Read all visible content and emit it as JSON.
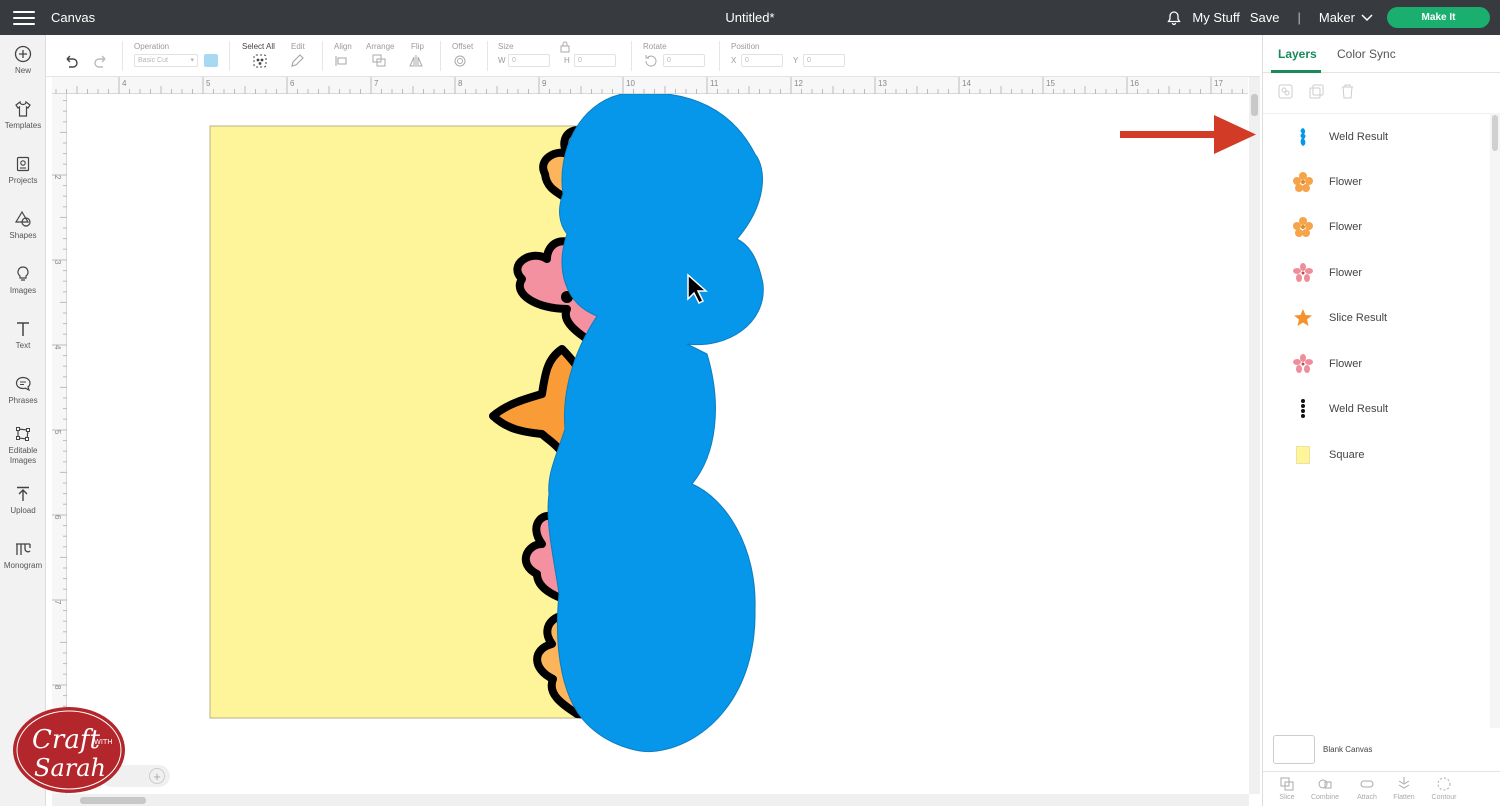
{
  "topbar": {
    "app_title": "Canvas",
    "doc_title": "Untitled*",
    "my_stuff": "My Stuff",
    "save": "Save",
    "separator": "|",
    "machine": "Maker",
    "make_it": "Make It"
  },
  "sidebar": {
    "items": [
      {
        "label": "New",
        "icon": "plus-circle-icon"
      },
      {
        "label": "Templates",
        "icon": "shirt-icon"
      },
      {
        "label": "Projects",
        "icon": "projects-icon"
      },
      {
        "label": "Shapes",
        "icon": "shapes-icon"
      },
      {
        "label": "Images",
        "icon": "lightbulb-icon"
      },
      {
        "label": "Text",
        "icon": "text-icon"
      },
      {
        "label": "Phrases",
        "icon": "speech-bubble-icon"
      },
      {
        "label": "Editable Images",
        "icon": "editable-images-icon"
      },
      {
        "label": "Upload",
        "icon": "upload-icon"
      },
      {
        "label": "Monogram",
        "icon": "monogram-icon"
      }
    ]
  },
  "toolbar": {
    "operation_label": "Operation",
    "operation_value": "Basic Cut",
    "operation_color": "#a9d8f2",
    "select_all": "Select All",
    "edit": "Edit",
    "align": "Align",
    "arrange": "Arrange",
    "flip": "Flip",
    "offset": "Offset",
    "size": "Size",
    "w": "W",
    "w_value": "0",
    "h": "H",
    "h_value": "0",
    "rotate": "Rotate",
    "rotate_value": "0",
    "position": "Position",
    "x": "X",
    "x_value": "0",
    "y": "Y",
    "y_value": "0"
  },
  "ruler": {
    "top_ticks": [
      "3",
      "4",
      "5",
      "6",
      "7",
      "8",
      "9",
      "10",
      "11",
      "12",
      "13",
      "14",
      "15",
      "16",
      "17"
    ],
    "left_ticks": [
      "1",
      "2",
      "3",
      "4",
      "5",
      "6",
      "7",
      "8"
    ]
  },
  "panel": {
    "tabs": [
      "Layers",
      "Color Sync"
    ],
    "layers": [
      {
        "name": "Weld Result",
        "icon": "blue-weld-icon",
        "color": "#0696ea"
      },
      {
        "name": "Flower",
        "icon": "flower-icon",
        "color": "#f5a44a"
      },
      {
        "name": "Flower",
        "icon": "flower-icon",
        "color": "#f5a44a"
      },
      {
        "name": "Flower",
        "icon": "flower-icon",
        "color": "#f08d9a"
      },
      {
        "name": "Slice Result",
        "icon": "star-flower-icon",
        "color": "#f5922d"
      },
      {
        "name": "Flower",
        "icon": "flower-icon",
        "color": "#f08d9a"
      },
      {
        "name": "Weld Result",
        "icon": "black-weld-icon",
        "color": "#111111"
      },
      {
        "name": "Square",
        "icon": "square-icon",
        "color": "#fef59b"
      }
    ],
    "blank_canvas": "Blank Canvas",
    "bottom_actions": [
      "Slice",
      "Combine",
      "Attach",
      "Flatten",
      "Contour"
    ]
  },
  "canvas": {
    "square_color": "#fef59b",
    "weld_color": "#0696ea"
  },
  "zoom": {
    "symbol": "+"
  },
  "logo": {
    "line1": "Craft",
    "with": "WITH",
    "line2": "Sarah"
  }
}
